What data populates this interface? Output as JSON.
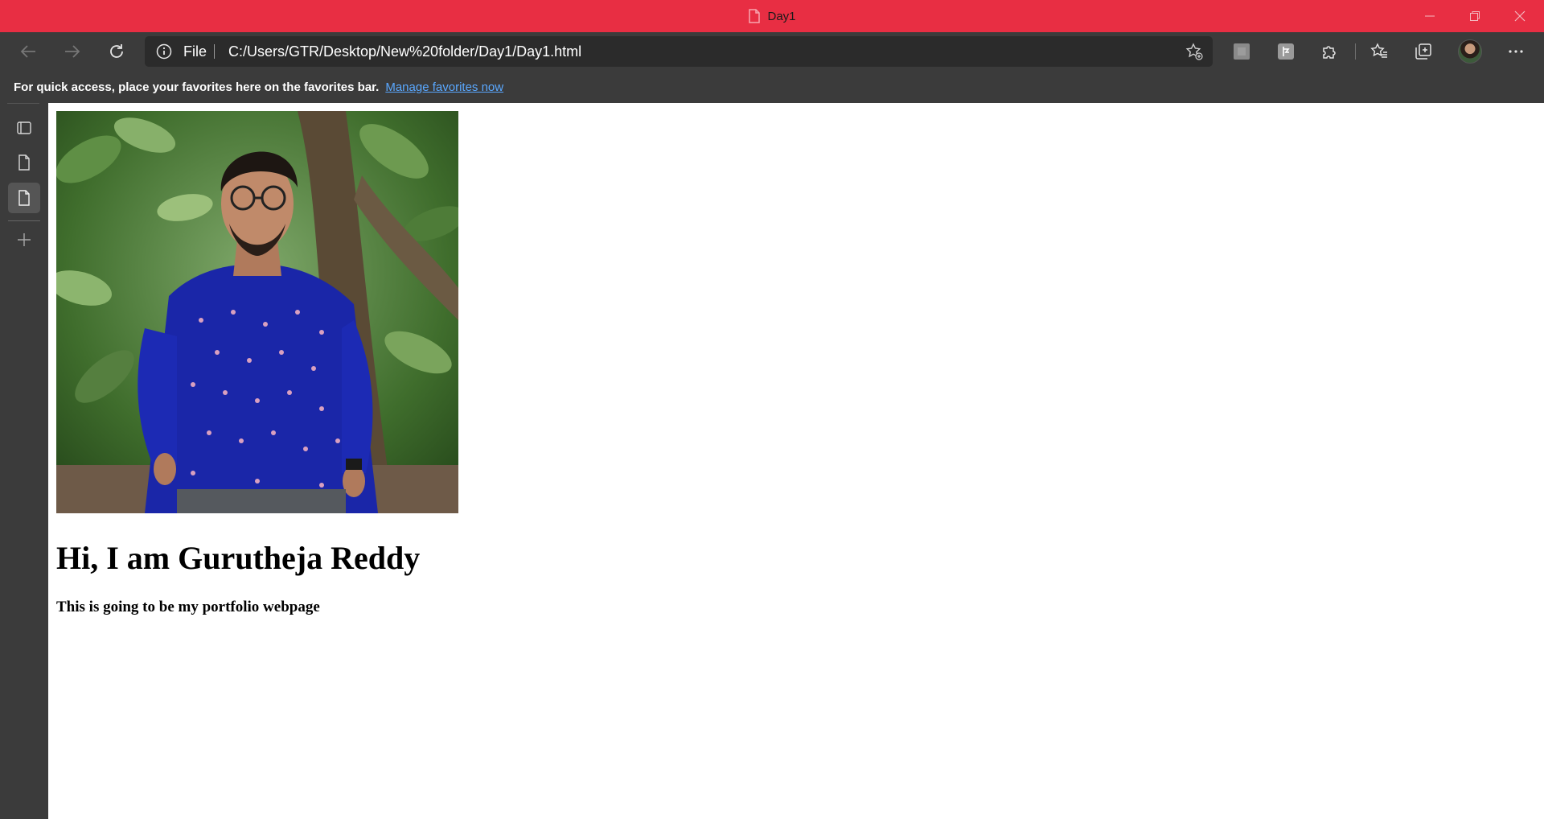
{
  "window": {
    "tab_title": "Day1",
    "accent_color": "#e82e43"
  },
  "toolbar": {
    "scheme_label": "File",
    "url": "C:/Users/GTR/Desktop/New%20folder/Day1/Day1.html"
  },
  "favorites_bar": {
    "message": "For quick access, place your favorites here on the favorites bar.",
    "link_label": "Manage favorites now"
  },
  "page": {
    "heading": "Hi, I am Gurutheja Reddy",
    "subheading": "This is going to be my portfolio webpage"
  },
  "icons": [
    "document-icon",
    "minimize-icon",
    "restore-icon",
    "close-icon",
    "back-icon",
    "forward-icon",
    "refresh-icon",
    "info-icon",
    "add-favorite-icon",
    "extension-icon",
    "puzzle-icon",
    "favorites-icon",
    "collections-icon",
    "avatar",
    "more-icon",
    "tab-actions-icon",
    "page-icon",
    "new-tab-icon"
  ]
}
